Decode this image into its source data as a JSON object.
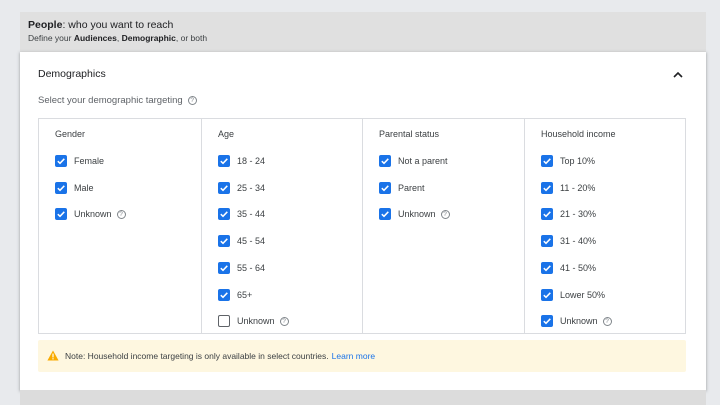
{
  "header": {
    "title_bold": "People",
    "title_rest": ": who you want to reach",
    "sub_prefix": "Define your ",
    "sub_audiences": "Audiences",
    "sub_sep": ", ",
    "sub_demographic": "Demographic",
    "sub_suffix": ", or both"
  },
  "card": {
    "title": "Demographics",
    "subtitle": "Select your demographic targeting",
    "help_glyph": "?"
  },
  "columns": [
    {
      "heading": "Gender",
      "options": [
        {
          "label": "Female",
          "checked": true,
          "help": false
        },
        {
          "label": "Male",
          "checked": true,
          "help": false
        },
        {
          "label": "Unknown",
          "checked": true,
          "help": true
        }
      ]
    },
    {
      "heading": "Age",
      "options": [
        {
          "label": "18 - 24",
          "checked": true,
          "help": false
        },
        {
          "label": "25 - 34",
          "checked": true,
          "help": false
        },
        {
          "label": "35 - 44",
          "checked": true,
          "help": false
        },
        {
          "label": "45 - 54",
          "checked": true,
          "help": false
        },
        {
          "label": "55 - 64",
          "checked": true,
          "help": false
        },
        {
          "label": "65+",
          "checked": true,
          "help": false
        },
        {
          "label": "Unknown",
          "checked": false,
          "help": true
        }
      ]
    },
    {
      "heading": "Parental status",
      "options": [
        {
          "label": "Not a parent",
          "checked": true,
          "help": false
        },
        {
          "label": "Parent",
          "checked": true,
          "help": false
        },
        {
          "label": "Unknown",
          "checked": true,
          "help": true
        }
      ]
    },
    {
      "heading": "Household income",
      "options": [
        {
          "label": "Top 10%",
          "checked": true,
          "help": false
        },
        {
          "label": "11 - 20%",
          "checked": true,
          "help": false
        },
        {
          "label": "21 - 30%",
          "checked": true,
          "help": false
        },
        {
          "label": "31 - 40%",
          "checked": true,
          "help": false
        },
        {
          "label": "41 - 50%",
          "checked": true,
          "help": false
        },
        {
          "label": "Lower 50%",
          "checked": true,
          "help": false
        },
        {
          "label": "Unknown",
          "checked": true,
          "help": true
        }
      ]
    }
  ],
  "note": {
    "text": "Note: Household income targeting is only available in select countries.",
    "link": "Learn more"
  },
  "colors": {
    "accent": "#1a73e8",
    "warning": "#f9ab00",
    "note_bg": "#fef7e0"
  }
}
